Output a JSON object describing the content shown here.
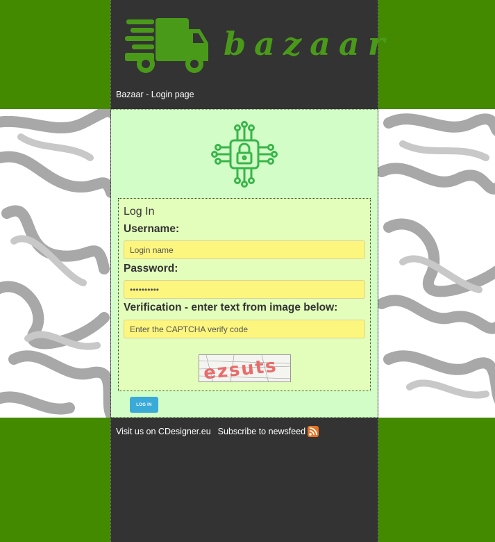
{
  "header": {
    "logo_text": "bazaar",
    "page_title": "Bazaar - Login page"
  },
  "login": {
    "legend": "Log In",
    "username_label": "Username:",
    "username_placeholder": "Login name",
    "password_label": "Password:",
    "password_value": "••••••••••",
    "verification_label": "Verification - enter text from image below:",
    "captcha_placeholder": "Enter the CAPTCHA verify code",
    "captcha_image_text": "ezsuts",
    "login_button": "LOG IN"
  },
  "footer": {
    "visit_link": "Visit us on CDesigner.eu",
    "subscribe_link": "Subscribe to newsfeed",
    "rss_icon": "rss-icon"
  },
  "colors": {
    "page_background": "#438a00",
    "column_background": "#333333",
    "content_background": "#d2fdc6",
    "login_box_background": "#e3fdbb",
    "input_background": "#fcf57e",
    "accent_green": "#4a9a1a",
    "button": "#3aaad8",
    "rss": "#e77425"
  }
}
